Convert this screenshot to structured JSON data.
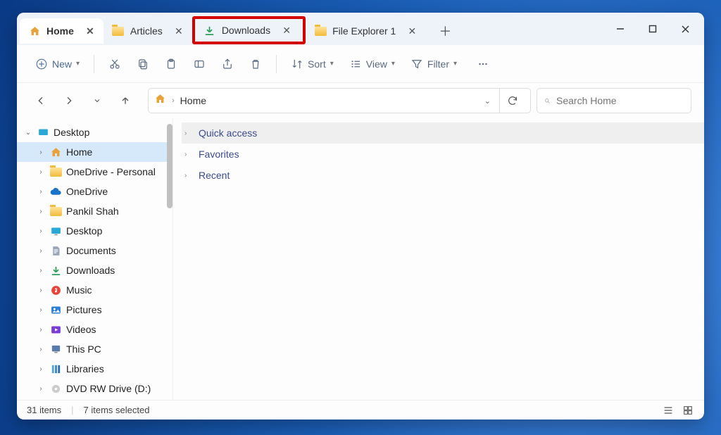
{
  "tabs": [
    {
      "label": "Home",
      "icon": "home",
      "active": true
    },
    {
      "label": "Articles",
      "icon": "folder",
      "active": false
    },
    {
      "label": "Downloads",
      "icon": "download",
      "active": false,
      "highlighted": true
    },
    {
      "label": "File Explorer 1",
      "icon": "folder",
      "active": false
    }
  ],
  "toolbar": {
    "new_label": "New",
    "sort_label": "Sort",
    "view_label": "View",
    "filter_label": "Filter"
  },
  "address": {
    "segments": [
      "Home"
    ]
  },
  "search": {
    "placeholder": "Search Home"
  },
  "sidebar": {
    "root": {
      "label": "Desktop",
      "icon": "desktop-solid",
      "expanded": true
    },
    "items": [
      {
        "label": "Home",
        "icon": "home",
        "selected": true
      },
      {
        "label": "OneDrive - Personal",
        "icon": "folder"
      },
      {
        "label": "OneDrive",
        "icon": "cloud"
      },
      {
        "label": "Pankil Shah",
        "icon": "folder"
      },
      {
        "label": "Desktop",
        "icon": "desktop"
      },
      {
        "label": "Documents",
        "icon": "document"
      },
      {
        "label": "Downloads",
        "icon": "download"
      },
      {
        "label": "Music",
        "icon": "music"
      },
      {
        "label": "Pictures",
        "icon": "pictures"
      },
      {
        "label": "Videos",
        "icon": "videos"
      },
      {
        "label": "This PC",
        "icon": "thispc"
      },
      {
        "label": "Libraries",
        "icon": "libraries"
      },
      {
        "label": "DVD RW Drive (D:)",
        "icon": "dvd"
      }
    ]
  },
  "content": {
    "sections": [
      {
        "label": "Quick access",
        "highlighted": true
      },
      {
        "label": "Favorites"
      },
      {
        "label": "Recent"
      }
    ]
  },
  "status": {
    "count_text": "31 items",
    "selection_text": "7 items selected"
  }
}
